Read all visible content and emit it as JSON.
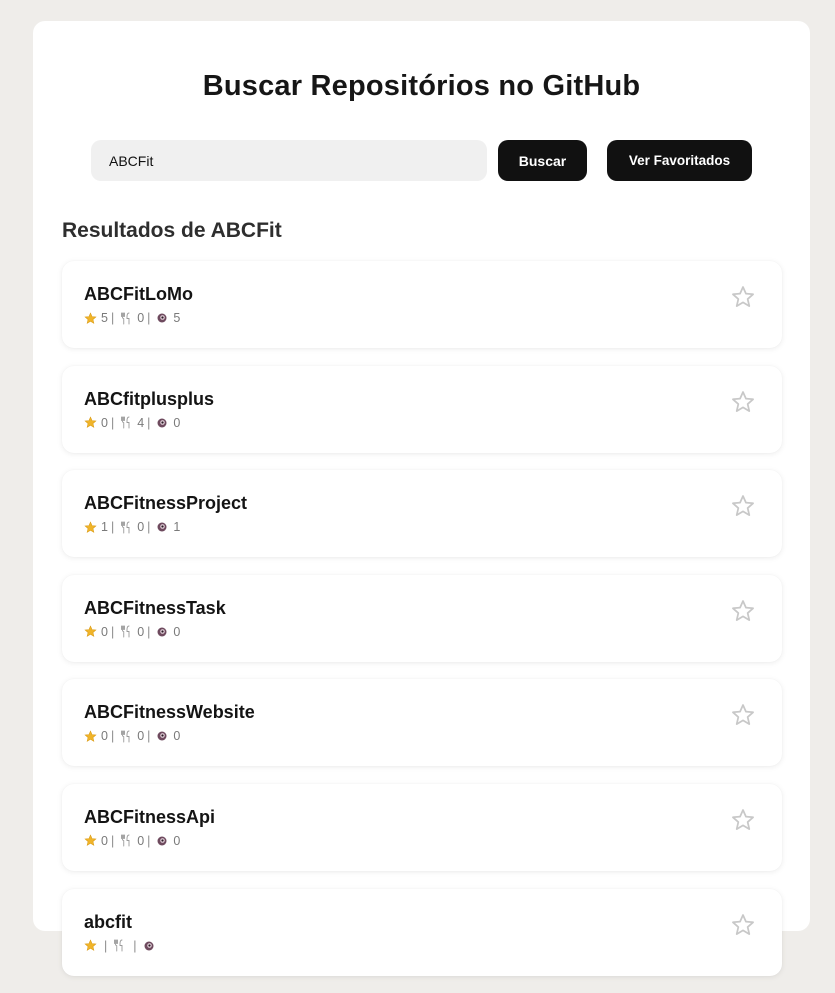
{
  "header": {
    "title": "Buscar Repositórios no GitHub"
  },
  "search": {
    "value": "ABCFit",
    "search_label": "Buscar",
    "favorites_label": "Ver Favoritados"
  },
  "results": {
    "heading": "Resultados de ABCFit",
    "repos": [
      {
        "name": "ABCFitLoMo",
        "stars": "5",
        "forks": "0",
        "watchers": "5",
        "favorited": false
      },
      {
        "name": "ABCfitplusplus",
        "stars": "0",
        "forks": "4",
        "watchers": "0",
        "favorited": false
      },
      {
        "name": "ABCFitnessProject",
        "stars": "1",
        "forks": "0",
        "watchers": "1",
        "favorited": false
      },
      {
        "name": "ABCFitnessTask",
        "stars": "0",
        "forks": "0",
        "watchers": "0",
        "favorited": false
      },
      {
        "name": "ABCFitnessWebsite",
        "stars": "0",
        "forks": "0",
        "watchers": "0",
        "favorited": false
      },
      {
        "name": "ABCFitnessApi",
        "stars": "0",
        "forks": "0",
        "watchers": "0",
        "favorited": false
      },
      {
        "name": "abcfit",
        "stars": "",
        "forks": "",
        "watchers": "",
        "favorited": false
      }
    ]
  },
  "colors": {
    "background": "#efedea",
    "card": "#ffffff",
    "button": "#111111",
    "star_stat": "#f0b429",
    "favorite_outline": "#c8c8c8"
  },
  "icons": {
    "stars_stat": "star-icon",
    "forks_stat": "fork-icon",
    "watchers_stat": "eye-icon",
    "favorite": "star-outline-icon"
  }
}
